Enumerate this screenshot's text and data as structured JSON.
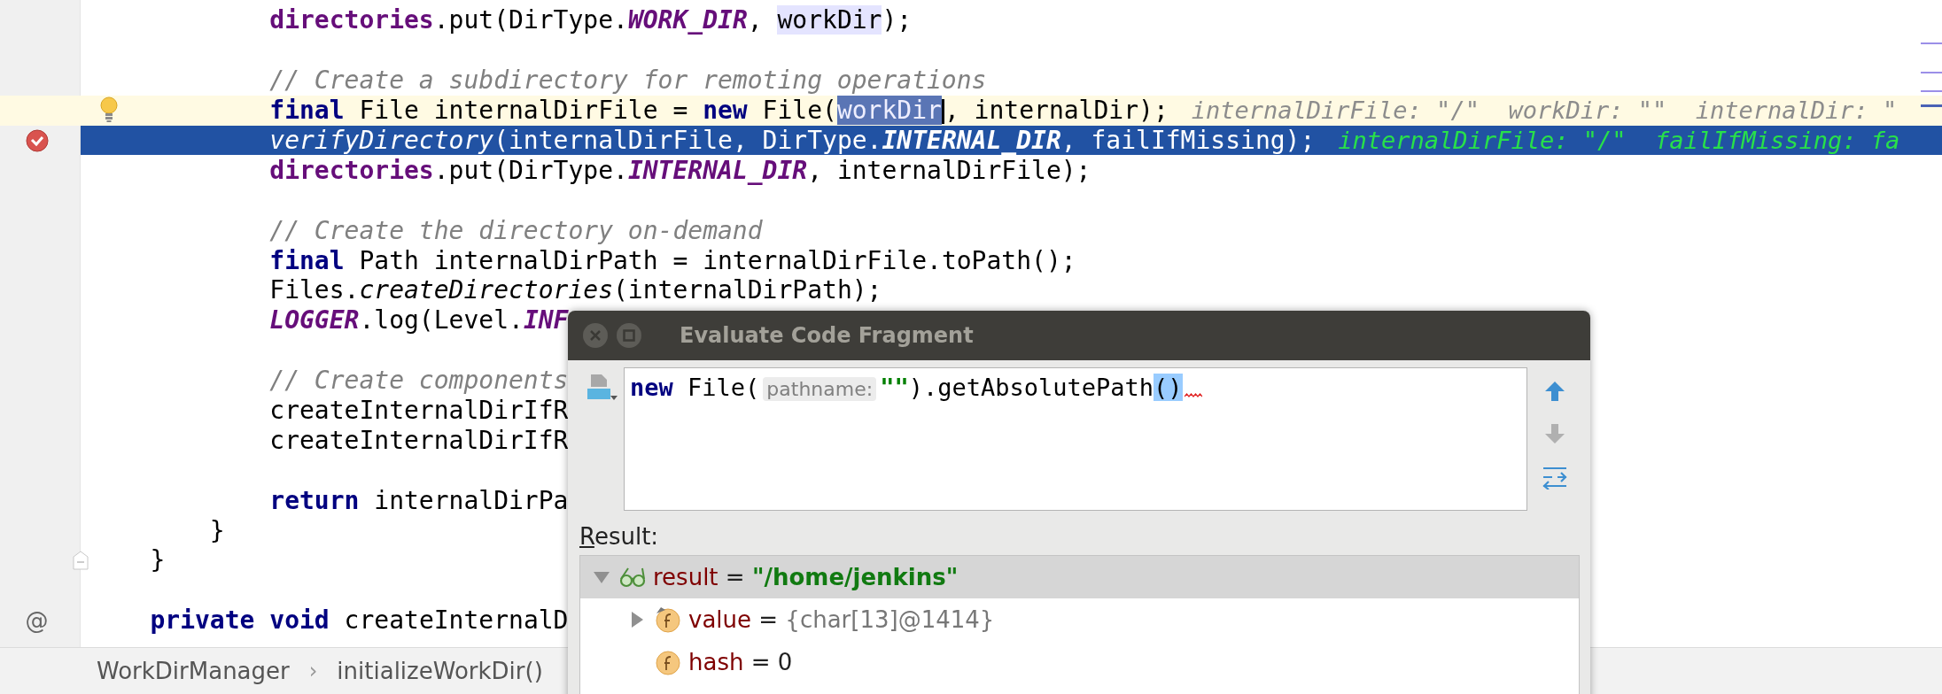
{
  "editor": {
    "lines": [
      {
        "kind": "code",
        "tokens": [
          {
            "text": "            directories",
            "kind": "field"
          },
          {
            "text": ".put(DirType.",
            "kind": "plain"
          },
          {
            "text": "WORK_DIR",
            "kind": "const"
          },
          {
            "text": ", ",
            "kind": "plain"
          },
          {
            "text": "workDir",
            "kind": "usage"
          },
          {
            "text": ");",
            "kind": "plain"
          }
        ]
      },
      {
        "kind": "blank"
      },
      {
        "kind": "code",
        "tokens": [
          {
            "text": "            // Create a subdirectory for remoting operations",
            "kind": "comment"
          }
        ]
      },
      {
        "kind": "code",
        "caret_line": true,
        "gutter": {
          "kind": "bulb"
        },
        "tokens": [
          {
            "text": "            final",
            "kind": "kw"
          },
          {
            "text": " File internalDirFile = ",
            "kind": "plain"
          },
          {
            "text": "new",
            "kind": "kw"
          },
          {
            "text": " File(",
            "kind": "plain"
          },
          {
            "text": "workDir",
            "kind": "selection",
            "caret_after": true
          },
          {
            "text": ", internalDir);",
            "kind": "plain"
          }
        ],
        "inline_values": "internalDirFile: \"/\"  workDir: \"\"  internalDir: \""
      },
      {
        "kind": "code",
        "execution_point": true,
        "gutter": {
          "kind": "breakpoint"
        },
        "tokens": [
          {
            "text": "            verifyDirectory",
            "kind": "static"
          },
          {
            "text": "(internalDirFile, DirType.",
            "kind": "plain"
          },
          {
            "text": "INTERNAL_DIR",
            "kind": "const"
          },
          {
            "text": ", failIfMissing);",
            "kind": "plain"
          }
        ],
        "inline_values": "internalDirFile: \"/\"  failIfMissing: fa"
      },
      {
        "kind": "code",
        "tokens": [
          {
            "text": "            directories",
            "kind": "field"
          },
          {
            "text": ".put(DirType.",
            "kind": "plain"
          },
          {
            "text": "INTERNAL_DIR",
            "kind": "const"
          },
          {
            "text": ", internalDirFile);",
            "kind": "plain"
          }
        ]
      },
      {
        "kind": "blank"
      },
      {
        "kind": "code",
        "tokens": [
          {
            "text": "            // Create the directory on-demand",
            "kind": "comment"
          }
        ]
      },
      {
        "kind": "code",
        "tokens": [
          {
            "text": "            final",
            "kind": "kw"
          },
          {
            "text": " Path internalDirPath = internalDirFile.toPath();",
            "kind": "plain"
          }
        ]
      },
      {
        "kind": "code",
        "tokens": [
          {
            "text": "            Files.",
            "kind": "plain"
          },
          {
            "text": "createDirectories",
            "kind": "static"
          },
          {
            "text": "(internalDirPath);",
            "kind": "plain"
          }
        ]
      },
      {
        "kind": "code",
        "tokens": [
          {
            "text": "            LOGGER",
            "kind": "const"
          },
          {
            "text": ".log(Level.",
            "kind": "plain"
          },
          {
            "text": "INF",
            "kind": "const"
          }
        ]
      },
      {
        "kind": "blank"
      },
      {
        "kind": "code",
        "tokens": [
          {
            "text": "            // Create components",
            "kind": "comment"
          }
        ]
      },
      {
        "kind": "code",
        "tokens": [
          {
            "text": "            createInternalDirIfR",
            "kind": "plain"
          }
        ]
      },
      {
        "kind": "code",
        "tokens": [
          {
            "text": "            createInternalDirIfR",
            "kind": "plain"
          }
        ]
      },
      {
        "kind": "blank"
      },
      {
        "kind": "code",
        "tokens": [
          {
            "text": "            return",
            "kind": "kw"
          },
          {
            "text": " internalDirPa",
            "kind": "plain"
          }
        ]
      },
      {
        "kind": "code",
        "tokens": [
          {
            "text": "        }",
            "kind": "plain"
          }
        ]
      },
      {
        "kind": "code",
        "gutter": {
          "kind": "fold"
        },
        "tokens": [
          {
            "text": "    }",
            "kind": "plain"
          }
        ]
      },
      {
        "kind": "blank"
      },
      {
        "kind": "code",
        "gutter": {
          "kind": "annotation",
          "text": "@"
        },
        "tokens": [
          {
            "text": "    private",
            "kind": "kw"
          },
          {
            "text": " void",
            "kind": "kw"
          },
          {
            "text": " createInternalD",
            "kind": "plain"
          }
        ]
      }
    ]
  },
  "breadcrumbs": [
    {
      "text": "WorkDirManager",
      "kind": "item"
    },
    {
      "text": "›",
      "kind": "separator"
    },
    {
      "text": "initializeWorkDir()",
      "kind": "item"
    }
  ],
  "dialog": {
    "title": "Evaluate Code Fragment",
    "expression": {
      "tokens": [
        {
          "text": "new",
          "kind": "kw"
        },
        {
          "text": " File(",
          "kind": "plain"
        },
        {
          "text": "pathname:",
          "kind": "hint"
        },
        {
          "text": "\"\"",
          "kind": "string"
        },
        {
          "text": ").getAbsolutePath",
          "kind": "plain"
        },
        {
          "text": "()",
          "kind": "brace"
        }
      ],
      "has_error": true
    },
    "nav_buttons": [
      {
        "kind": "up",
        "disabled": false
      },
      {
        "kind": "down",
        "disabled": true
      },
      {
        "kind": "options",
        "disabled": false
      }
    ],
    "result_label": "Result:",
    "result_tree": [
      {
        "kind": "watch",
        "name": "result",
        "operator": "=",
        "value": {
          "text": "\"/home/jenkins\"",
          "kind": "string"
        },
        "expanded": true,
        "selected": true,
        "children": [
          {
            "kind": "field",
            "name": "value",
            "operator": "=",
            "value": {
              "text": "{char[13]@1414}",
              "kind": "ref"
            },
            "expanded": false,
            "selected": false,
            "marked": true
          },
          {
            "kind": "field",
            "name": "hash",
            "operator": "=",
            "value": {
              "text": "0",
              "kind": "number"
            },
            "selected": false,
            "marked": false
          }
        ]
      }
    ]
  }
}
